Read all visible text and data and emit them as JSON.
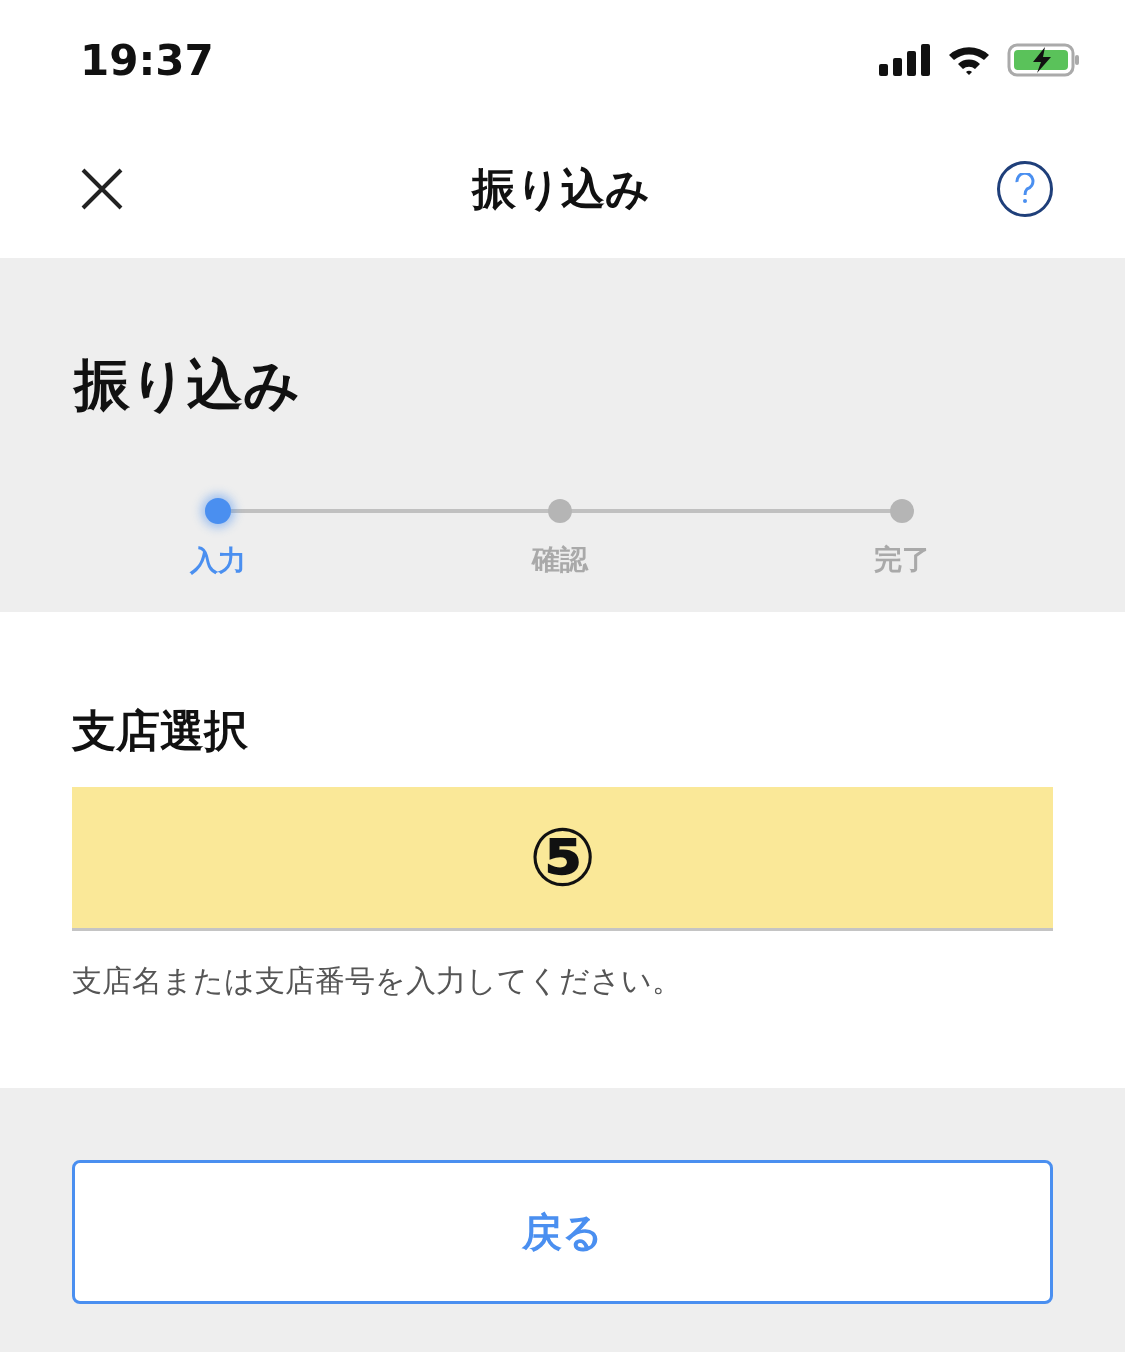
{
  "status_bar": {
    "time": "19:37"
  },
  "header": {
    "title": "振り込み"
  },
  "page_title": "振り込み",
  "steps": [
    {
      "label": "入力",
      "selected": true
    },
    {
      "label": "確認",
      "selected": false
    },
    {
      "label": "完了",
      "selected": false
    }
  ],
  "branch": {
    "label": "支店選択",
    "annotation": "⑤",
    "hint": "支店名または支店番号を入力してください。"
  },
  "buttons": {
    "back": "戻る"
  }
}
